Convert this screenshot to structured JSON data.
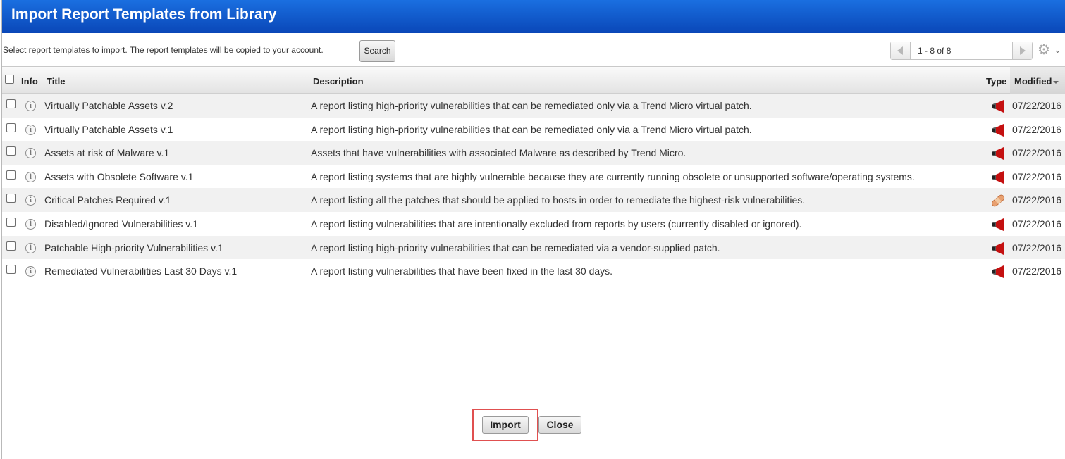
{
  "dialog": {
    "title": "Import Report Templates from Library"
  },
  "toolbar": {
    "intro_text": "Select report templates to import. The report templates will be copied to your account.",
    "search_label": "Search",
    "pager_range": "1 - 8 of 8",
    "settings_icon": "gear-icon"
  },
  "table": {
    "headers": {
      "info": "Info",
      "title": "Title",
      "description": "Description",
      "type": "Type",
      "modified": "Modified"
    },
    "sort": {
      "column": "Modified",
      "direction": "descending"
    },
    "rows": [
      {
        "title": "Virtually Patchable Assets v.2",
        "description": "A report listing high-priority vulnerabilities that can be remediated only via a Trend Micro virtual patch.",
        "type_icon": "alert-megaphone-icon",
        "modified": "07/22/2016"
      },
      {
        "title": "Virtually Patchable Assets v.1",
        "description": "A report listing high-priority vulnerabilities that can be remediated only via a Trend Micro virtual patch.",
        "type_icon": "alert-megaphone-icon",
        "modified": "07/22/2016"
      },
      {
        "title": "Assets at risk of Malware v.1",
        "description": "Assets that have vulnerabilities with associated Malware as described by Trend Micro.",
        "type_icon": "alert-megaphone-icon",
        "modified": "07/22/2016"
      },
      {
        "title": "Assets with Obsolete Software v.1",
        "description": "A report listing systems that are highly vulnerable because they are currently running obsolete or unsupported software/operating systems.",
        "type_icon": "alert-megaphone-icon",
        "modified": "07/22/2016"
      },
      {
        "title": "Critical Patches Required v.1",
        "description": "A report listing all the patches that should be applied to hosts in order to remediate the highest-risk vulnerabilities.",
        "type_icon": "patch-bandage-icon",
        "modified": "07/22/2016"
      },
      {
        "title": "Disabled/Ignored Vulnerabilities v.1",
        "description": "A report listing vulnerabilities that are intentionally excluded from reports by users (currently disabled or ignored).",
        "type_icon": "alert-megaphone-icon",
        "modified": "07/22/2016"
      },
      {
        "title": "Patchable High-priority Vulnerabilities v.1",
        "description": "A report listing high-priority vulnerabilities that can be remediated via a vendor-supplied patch.",
        "type_icon": "alert-megaphone-icon",
        "modified": "07/22/2016"
      },
      {
        "title": "Remediated Vulnerabilities Last 30 Days v.1",
        "description": "A report listing vulnerabilities that have been fixed in the last 30 days.",
        "type_icon": "alert-megaphone-icon",
        "modified": "07/22/2016"
      }
    ]
  },
  "footer": {
    "import_label": "Import",
    "close_label": "Close"
  },
  "colors": {
    "title_bar": "#0a47b8",
    "highlight": "#e05050",
    "megaphone": "#c41010",
    "bandage": "#e8a070"
  }
}
